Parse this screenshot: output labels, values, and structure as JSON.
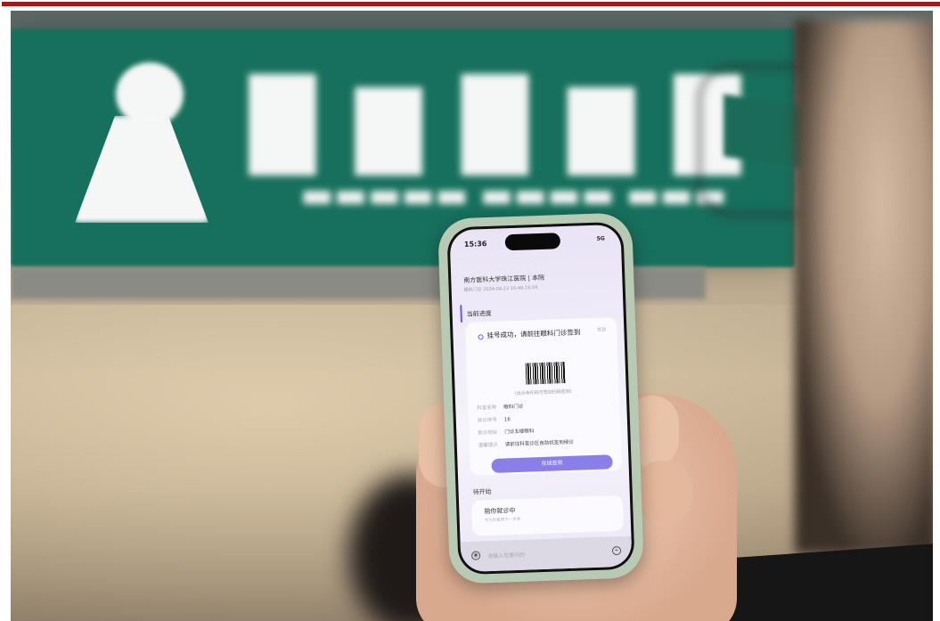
{
  "phone": {
    "status": {
      "time": "15:36",
      "network": "5G"
    },
    "hospital": {
      "name": "南方医科大学珠江医院 | 本院",
      "subtitle": "眼科门诊 2024-04-22 16:40-16:59"
    },
    "progress_section": {
      "title": "当前进度"
    },
    "status_card": {
      "status_text": "挂号成功，请前往眼科门诊签到",
      "status_right": "签到",
      "barcode_hint": "(出示条形码可签到扫码签到)",
      "rows": [
        {
          "label": "科室名称",
          "value": "眼科门诊"
        },
        {
          "label": "就诊序号",
          "value": "16"
        },
        {
          "label": "就诊地址",
          "value": "门诊五楼眼科"
        },
        {
          "label": "温馨提示",
          "value": "请前往科室诊区自助机签到候诊"
        }
      ],
      "button": "在线签到"
    },
    "pending_section": {
      "title": "待开始"
    },
    "pending_card": {
      "title": "陪你就诊中",
      "subtitle": "专为你整理下一步事"
    },
    "input_bar": {
      "placeholder": "请输入您要问的"
    }
  },
  "colors": {
    "accent": "#8a7ee8",
    "sign_green": "#17705d",
    "top_border": "#a01a1a"
  }
}
